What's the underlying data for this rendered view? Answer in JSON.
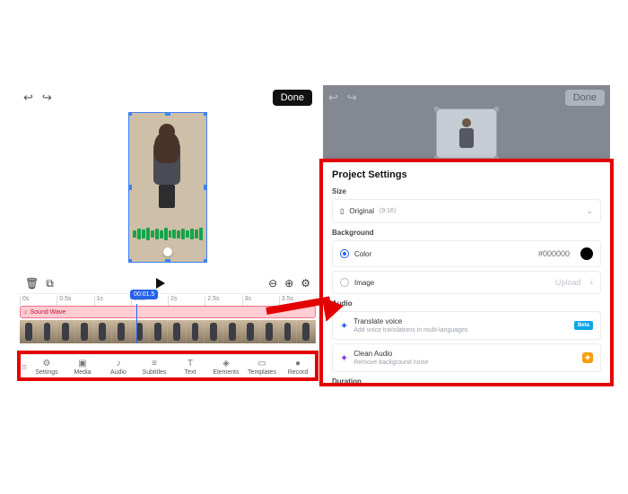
{
  "editor": {
    "done_label": "Done",
    "ruler_marks": [
      "0s",
      "0.5s",
      "1s",
      "1.5s",
      "2s",
      "2.5s",
      "3s",
      "3.5s"
    ],
    "playhead_time": "00:01.5",
    "sound_wave_label": "Sound Wave",
    "tabs": [
      {
        "icon": "⚙",
        "label": "Settings"
      },
      {
        "icon": "▣",
        "label": "Media"
      },
      {
        "icon": "♪",
        "label": "Audio"
      },
      {
        "icon": "≡",
        "label": "Subtitles"
      },
      {
        "icon": "T",
        "label": "Text"
      },
      {
        "icon": "◈",
        "label": "Elements"
      },
      {
        "icon": "▭",
        "label": "Templates"
      },
      {
        "icon": "●",
        "label": "Record"
      }
    ]
  },
  "settings": {
    "title": "Project Settings",
    "size_section": "Size",
    "size_option": "Original",
    "size_ratio": "(9:16)",
    "background_section": "Background",
    "bg_color_label": "Color",
    "bg_color_hex": "#000000",
    "bg_image_label": "Image",
    "bg_image_action": "Upload",
    "audio_section": "Audio",
    "translate_title": "Translate voice",
    "translate_sub": "Add voice translations in multi-languages",
    "translate_badge": "Beta",
    "clean_title": "Clean Audio",
    "clean_sub": "Remove background noise",
    "duration_section": "Duration"
  }
}
